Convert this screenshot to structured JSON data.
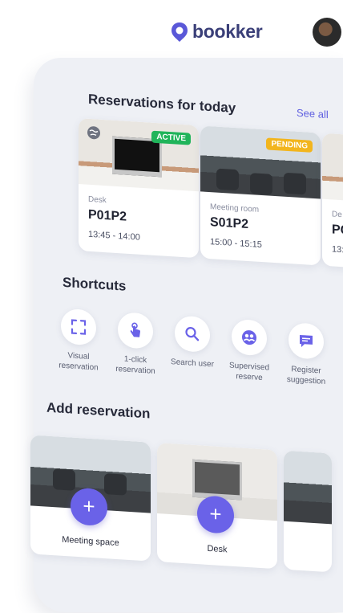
{
  "brand": {
    "name": "bookker",
    "color": "#3a3f78",
    "accent": "#6a62e8"
  },
  "reservations": {
    "title": "Reservations for today",
    "see_all": "See all",
    "items": [
      {
        "status": "ACTIVE",
        "type": "Desk",
        "code": "P01P2",
        "time": "13:45 - 14:00",
        "status_color": "#20b45a"
      },
      {
        "status": "PENDING",
        "type": "Meeting room",
        "code": "S01P2",
        "time": "15:00 - 15:15",
        "status_color": "#f2b51d"
      },
      {
        "type": "De",
        "code": "PC",
        "time": "13:"
      }
    ]
  },
  "shortcuts": {
    "title": "Shortcuts",
    "items": [
      {
        "label": "Visual reservation",
        "icon": "scan-frame-icon"
      },
      {
        "label": "1-click reservation",
        "icon": "tap-hand-icon"
      },
      {
        "label": "Search user",
        "icon": "search-icon"
      },
      {
        "label": "Supervised reserve",
        "icon": "supervised-icon"
      },
      {
        "label": "Register suggestion",
        "icon": "chat-icon"
      }
    ]
  },
  "add_reservation": {
    "title": "Add reservation",
    "items": [
      {
        "label": "Meeting space"
      },
      {
        "label": "Desk"
      }
    ],
    "button_symbol": "+"
  }
}
